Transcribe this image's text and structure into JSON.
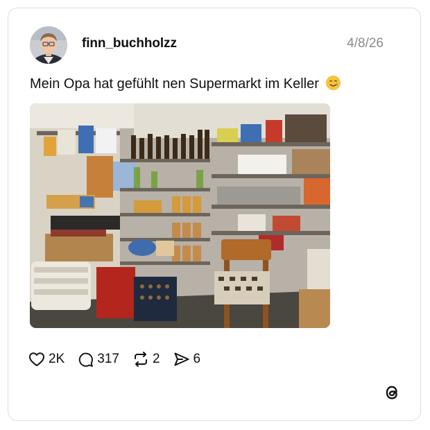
{
  "post": {
    "username": "finn_buchholzz",
    "date": "4/8/26",
    "text": "Mein Opa hat gefühlt nen Supermarkt im Keller",
    "emoji": "smiling-face-with-tear-emoji",
    "image": "basement-pantry-shelves-photo"
  },
  "stats": {
    "likes": "2K",
    "replies": "317",
    "reposts": "2",
    "shares": "6"
  },
  "icons": {
    "like": "heart-icon",
    "reply": "speech-bubble-icon",
    "repost": "repost-icon",
    "share": "send-icon",
    "brand": "threads-logo"
  },
  "colors": {
    "text": "#101010",
    "muted": "#8a8a8a",
    "border": "#dcdcdc"
  }
}
